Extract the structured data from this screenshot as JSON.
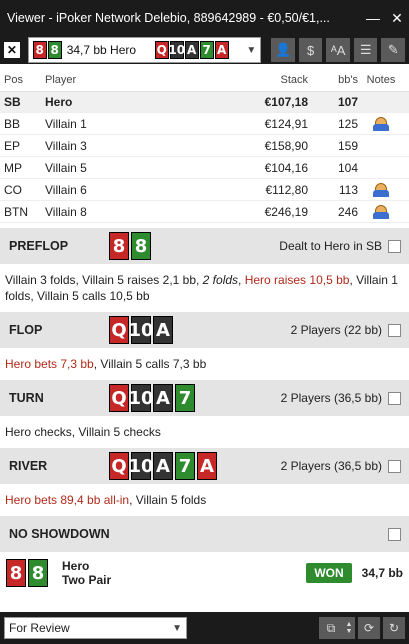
{
  "window": {
    "title": "Viewer - iPoker Network Delebio, 889642989 - €0,50/€1,...",
    "minimize": "—",
    "close": "✕"
  },
  "toolbar": {
    "close_glyph": "✕",
    "hand_select": {
      "cards": [
        {
          "rank": "8",
          "color": "red"
        },
        {
          "rank": "8",
          "color": "green"
        }
      ],
      "description": "34,7 bb Hero",
      "board": [
        {
          "rank": "Q",
          "color": "red"
        },
        {
          "rank": "10",
          "color": "black"
        },
        {
          "rank": "A",
          "color": "black"
        },
        {
          "rank": "7",
          "color": "green"
        },
        {
          "rank": "A",
          "color": "red"
        }
      ]
    },
    "icons": [
      "user-icon",
      "dollar-icon",
      "font-size-icon",
      "list-icon",
      "pencil-icon"
    ],
    "dollar_glyph": "$",
    "font_glyph": "ᴬA",
    "list_glyph": "☰",
    "pencil_glyph": "✎",
    "user_glyph": "👤"
  },
  "players": {
    "headers": {
      "pos": "Pos",
      "player": "Player",
      "stack": "Stack",
      "bb": "bb's",
      "notes": "Notes"
    },
    "rows": [
      {
        "pos": "SB",
        "name": "Hero",
        "stack": "€107,18",
        "bb": "107",
        "note": false
      },
      {
        "pos": "BB",
        "name": "Villain 1",
        "stack": "€124,91",
        "bb": "125",
        "note": true
      },
      {
        "pos": "EP",
        "name": "Villain 3",
        "stack": "€158,90",
        "bb": "159",
        "note": false
      },
      {
        "pos": "MP",
        "name": "Villain 5",
        "stack": "€104,16",
        "bb": "104",
        "note": false
      },
      {
        "pos": "CO",
        "name": "Villain 6",
        "stack": "€112,80",
        "bb": "113",
        "note": true
      },
      {
        "pos": "BTN",
        "name": "Villain 8",
        "stack": "€246,19",
        "bb": "246",
        "note": true
      }
    ]
  },
  "streets": {
    "preflop": {
      "name": "PREFLOP",
      "cards": [
        {
          "rank": "8",
          "color": "red"
        },
        {
          "rank": "8",
          "color": "green"
        }
      ],
      "info": "Dealt to Hero in SB",
      "actions": [
        {
          "text": "Villain 3 folds, Villain 5 raises 2,1 bb, ",
          "style": ""
        },
        {
          "text": "2 folds",
          "style": "it"
        },
        {
          "text": ", ",
          "style": ""
        },
        {
          "text": "Hero raises 10,5 bb",
          "style": "red"
        },
        {
          "text": ", Villain 1 folds, Villain 5 calls 10,5 bb",
          "style": ""
        }
      ]
    },
    "flop": {
      "name": "FLOP",
      "cards": [
        {
          "rank": "Q",
          "color": "red"
        },
        {
          "rank": "10",
          "color": "black"
        },
        {
          "rank": "A",
          "color": "black"
        }
      ],
      "info": "2 Players (22 bb)",
      "actions": [
        {
          "text": "Hero bets 7,3 bb",
          "style": "red"
        },
        {
          "text": ", Villain 5 calls 7,3 bb",
          "style": ""
        }
      ]
    },
    "turn": {
      "name": "TURN",
      "cards": [
        {
          "rank": "Q",
          "color": "red"
        },
        {
          "rank": "10",
          "color": "black"
        },
        {
          "rank": "A",
          "color": "black"
        },
        {
          "rank": "7",
          "color": "green"
        }
      ],
      "info": "2 Players (36,5 bb)",
      "actions": [
        {
          "text": "Hero checks, Villain 5 checks",
          "style": ""
        }
      ]
    },
    "river": {
      "name": "RIVER",
      "cards": [
        {
          "rank": "Q",
          "color": "red"
        },
        {
          "rank": "10",
          "color": "black"
        },
        {
          "rank": "A",
          "color": "black"
        },
        {
          "rank": "7",
          "color": "green"
        },
        {
          "rank": "A",
          "color": "red"
        }
      ],
      "info": "2 Players (36,5 bb)",
      "actions": [
        {
          "text": "Hero bets 89,4 bb all-in",
          "style": "red"
        },
        {
          "text": ", Villain 5 folds",
          "style": ""
        }
      ]
    },
    "showdown": {
      "name": "NO SHOWDOWN"
    }
  },
  "result": {
    "cards": [
      {
        "rank": "8",
        "color": "red"
      },
      {
        "rank": "8",
        "color": "green"
      }
    ],
    "player": "Hero",
    "hand": "Two Pair",
    "badge": "WON",
    "amount": "34,7 bb"
  },
  "footer": {
    "review_select": "For Review",
    "copy_glyph": "⧉",
    "stepper_glyph": "▲▼",
    "refresh_glyph": "⟳",
    "reload_glyph": "↻"
  },
  "colors": {
    "red_card": "#c62828",
    "green_card": "#2e8b2e",
    "black_card": "#333333",
    "won": "#2e8b2e",
    "action_red": "#b22a1a"
  }
}
